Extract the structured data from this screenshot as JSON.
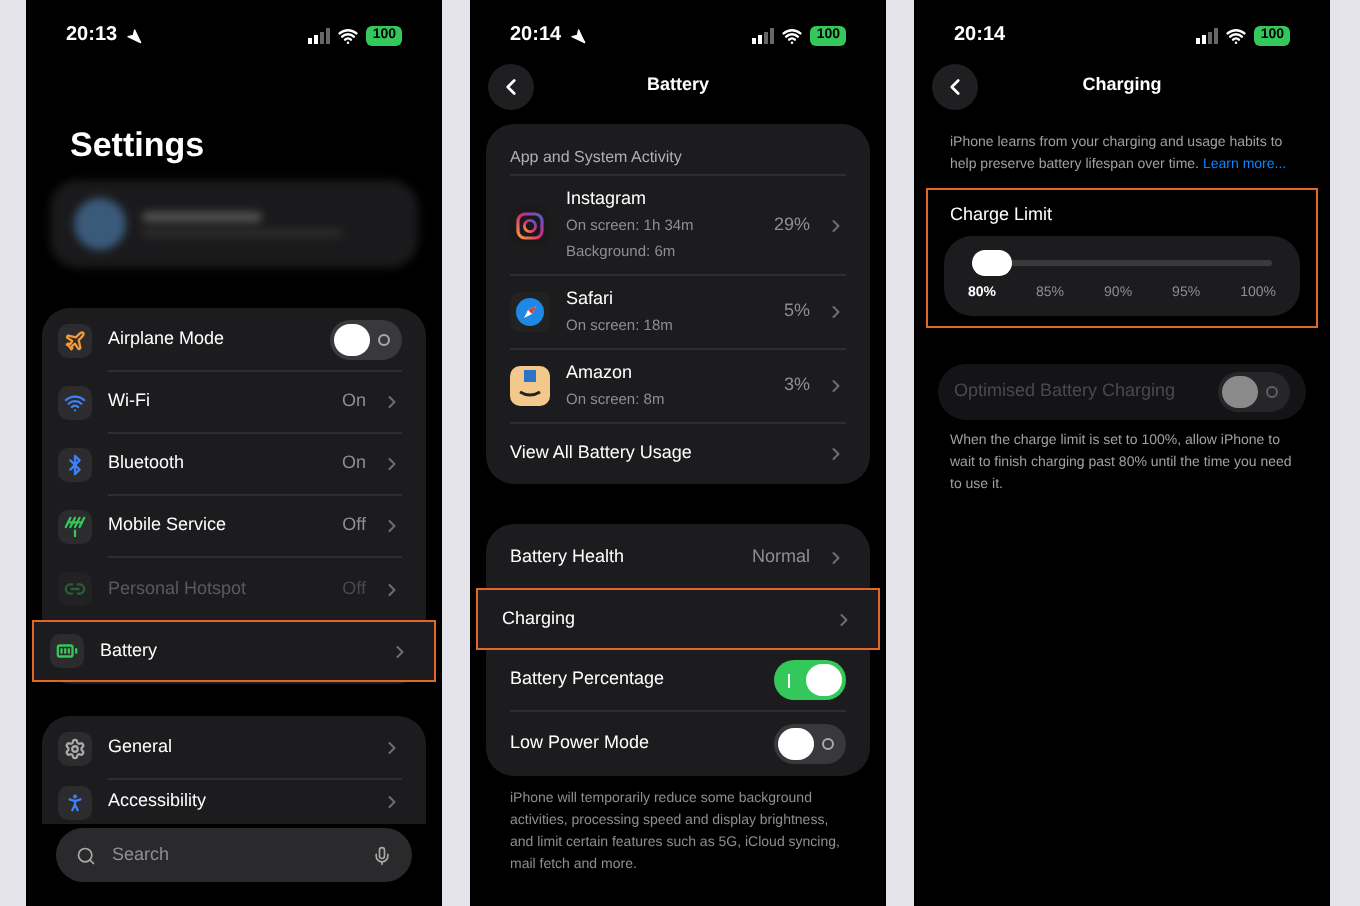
{
  "screens": [
    {
      "kind": "settings",
      "status_bar": {
        "time": "20:13",
        "location": true,
        "battery": "100"
      },
      "title": "Settings",
      "groups": [
        {
          "rows": [
            {
              "label": "Airplane Mode",
              "kind": "toggle",
              "on": false,
              "disabled": false,
              "highlighted": false
            },
            {
              "label": "Wi-Fi",
              "kind": "link",
              "value": "On",
              "disabled": false,
              "highlighted": false
            },
            {
              "label": "Bluetooth",
              "kind": "link",
              "value": "On",
              "disabled": false,
              "highlighted": false
            },
            {
              "label": "Mobile Service",
              "kind": "link",
              "value": "Off",
              "disabled": false,
              "highlighted": false
            },
            {
              "label": "Personal Hotspot",
              "kind": "link",
              "value": "Off",
              "disabled": true,
              "highlighted": false
            },
            {
              "label": "Battery",
              "kind": "link",
              "disabled": false,
              "highlighted": true
            }
          ]
        },
        {
          "rows": [
            {
              "label": "General",
              "kind": "link",
              "disabled": false,
              "highlighted": false
            },
            {
              "label": "Accessibility",
              "kind": "link",
              "disabled": false,
              "highlighted": false
            }
          ]
        }
      ],
      "search": {
        "placeholder": "Search"
      }
    },
    {
      "kind": "battery",
      "status_bar": {
        "time": "20:14",
        "location": true,
        "battery": "100"
      },
      "title": "Battery",
      "activity": {
        "header": "App and System Activity",
        "apps": [
          {
            "name": "Instagram",
            "details": [
              "On screen: 1h 34m",
              "Background: 6m"
            ],
            "percent": "29%"
          },
          {
            "name": "Safari",
            "details": [
              "On screen: 18m"
            ],
            "percent": "5%"
          },
          {
            "name": "Amazon",
            "details": [
              "On screen: 8m"
            ],
            "percent": "3%"
          }
        ],
        "view_all": "View All Battery Usage"
      },
      "rows": [
        {
          "label": "Battery Health",
          "kind": "link",
          "value": "Normal",
          "highlighted": false
        },
        {
          "label": "Charging",
          "kind": "link",
          "highlighted": true
        },
        {
          "label": "Battery Percentage",
          "kind": "toggle",
          "on": true,
          "highlighted": false
        },
        {
          "label": "Low Power Mode",
          "kind": "toggle",
          "on": false,
          "highlighted": false
        }
      ],
      "footnote": "iPhone will temporarily reduce some background activities, processing speed and display brightness, and limit certain features such as 5G, iCloud syncing, mail fetch and more."
    },
    {
      "kind": "charging",
      "status_bar": {
        "time": "20:14",
        "location": false,
        "battery": "100"
      },
      "title": "Charging",
      "description": "iPhone learns from your charging and usage habits to help preserve battery lifespan over time.",
      "link": "Learn more...",
      "charge_limit": {
        "label": "Charge Limit",
        "highlighted": true,
        "level": 0,
        "stops": [
          {
            "label": "80%",
            "selected": true
          },
          {
            "label": "85%",
            "selected": false
          },
          {
            "label": "90%",
            "selected": false
          },
          {
            "label": "95%",
            "selected": false
          },
          {
            "label": "100%",
            "selected": false
          }
        ]
      },
      "optimised": {
        "label": "Optimised Battery Charging",
        "on": false,
        "disabled": true
      },
      "footnote": "When the charge limit is set to 100%, allow iPhone to wait to finish charging past 80% until the time you need to use it."
    }
  ]
}
